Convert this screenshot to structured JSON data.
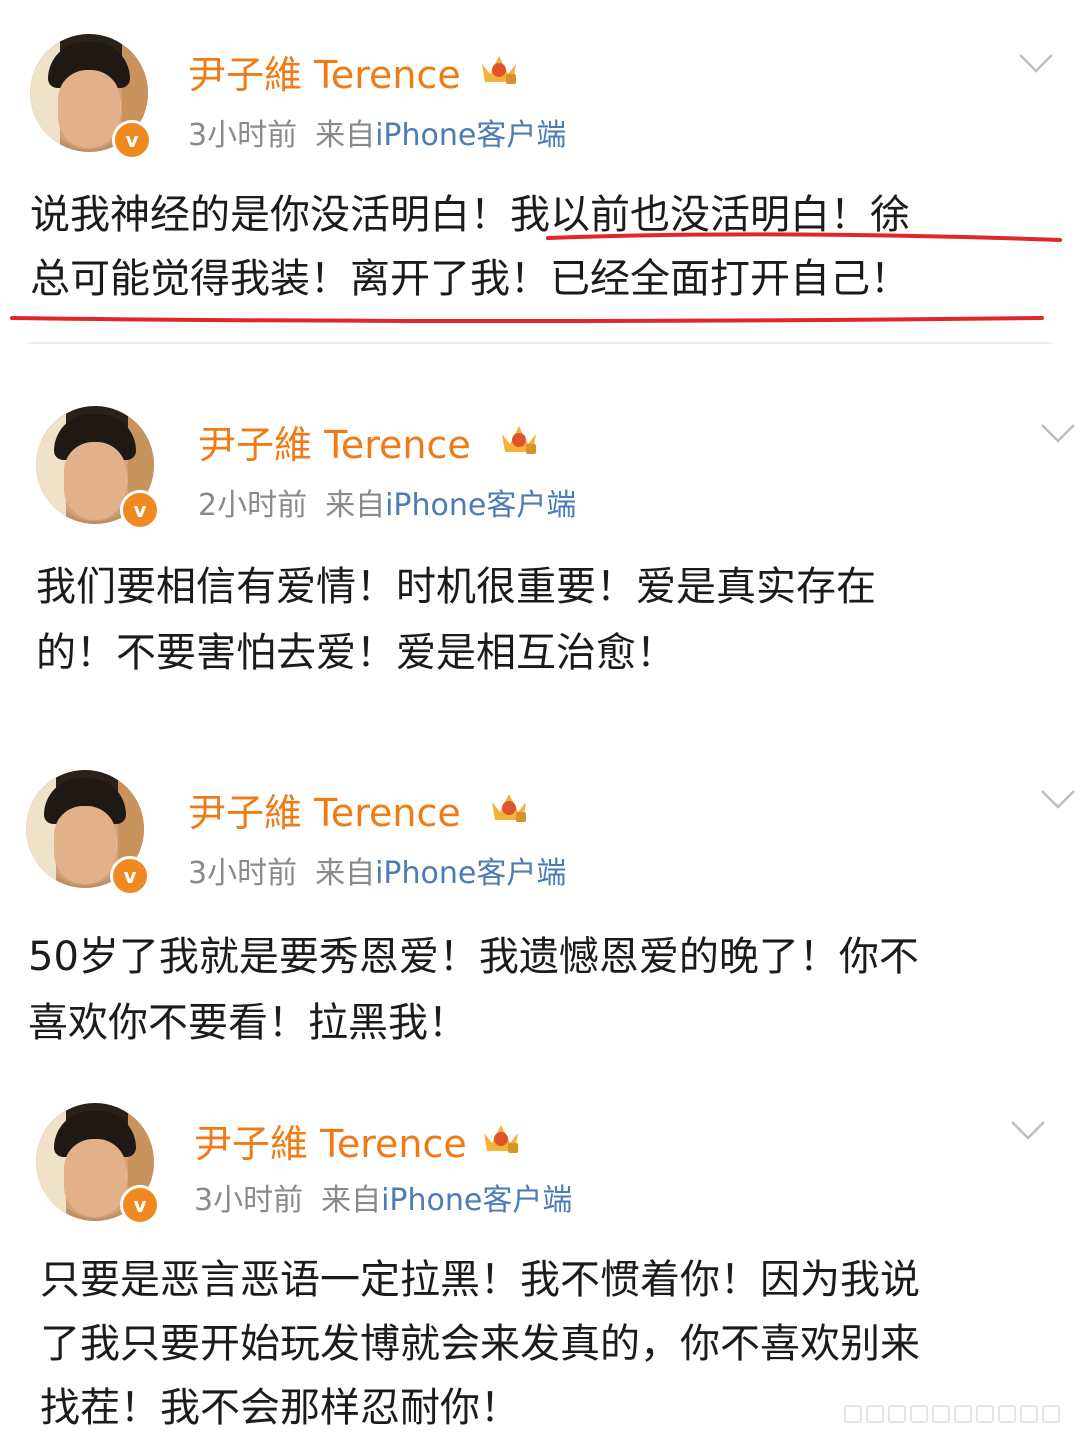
{
  "posts": [
    {
      "author": "尹子維 Terence",
      "time": "3小时前",
      "from_label": "来自",
      "source": "iPhone客户端",
      "line1": "说我神经的是你没活明白！我以前也没活明白！徐",
      "line2": "总可能觉得我装！离开了我！已经全面打开自己！",
      "line3": ""
    },
    {
      "author": "尹子維 Terence",
      "time": "2小时前",
      "from_label": "来自",
      "source": "iPhone客户端",
      "line1": "我们要相信有爱情！时机很重要！爱是真实存在",
      "line2": "的！不要害怕去爱！爱是相互治愈！",
      "line3": ""
    },
    {
      "author": "尹子維 Terence",
      "time": "3小时前",
      "from_label": "来自",
      "source": "iPhone客户端",
      "line1": "50岁了我就是要秀恩爱！我遗憾恩爱的晚了！你不",
      "line2": "喜欢你不要看！拉黑我！",
      "line3": ""
    },
    {
      "author": "尹子維 Terence",
      "time": "3小时前",
      "from_label": "来自",
      "source": "iPhone客户端",
      "line1": "只要是恶言恶语一定拉黑！我不惯着你！因为我说",
      "line2": "了我只要开始玩发博就会来发真的，你不喜欢别来",
      "line3": "找茬！我不会那样忍耐你！"
    }
  ],
  "icons": {
    "verified_badge": "v",
    "crown": "crown-icon",
    "chevron": "chevron-down-icon"
  },
  "colors": {
    "name": "#f07b14",
    "source": "#4d7bb5",
    "meta": "#8a8a8a",
    "annotation": "#e0262b"
  }
}
